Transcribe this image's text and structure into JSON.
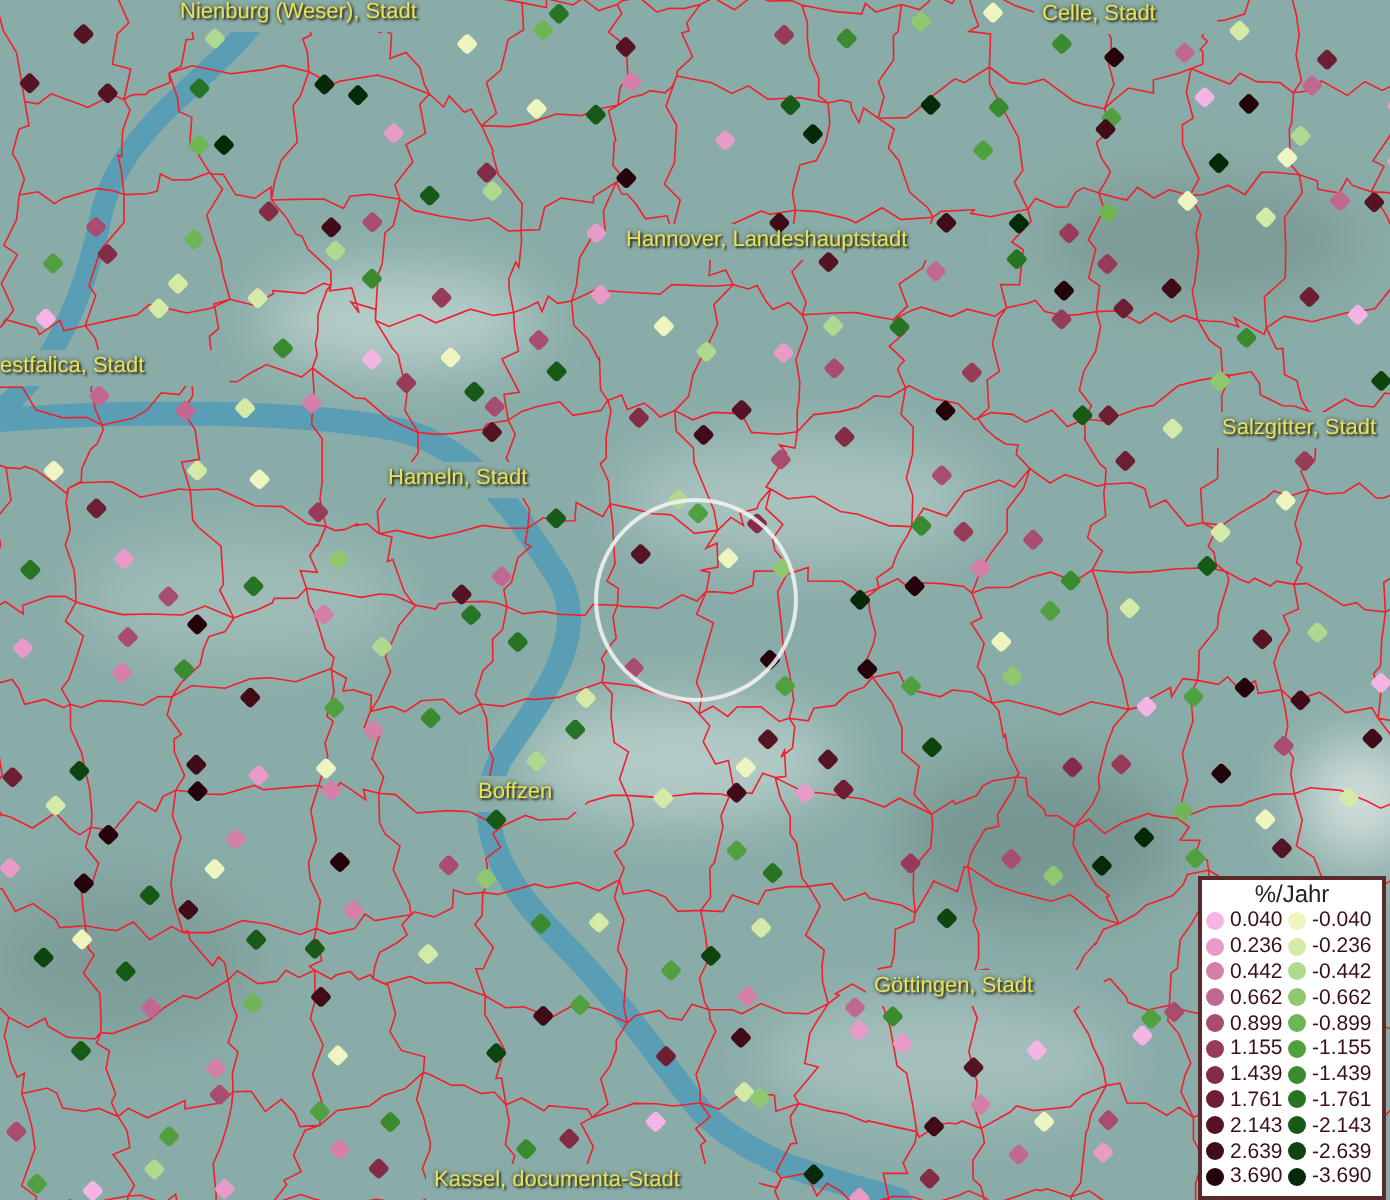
{
  "map": {
    "place_labels": [
      "Nienburg (Weser), Stadt",
      "Celle, Stadt",
      "Hannover, Landeshauptstadt",
      "estfalica, Stadt",
      "Salzgitter, Stadt",
      "Hameln, Stadt",
      "Boffzen",
      "Göttingen, Stadt",
      "Kassel, documenta-Stadt"
    ]
  },
  "legend": {
    "title": "%/Jahr",
    "entries": [
      {
        "label": "0.040",
        "color": "#f5b4e6"
      },
      {
        "label": "-0.040",
        "color": "#eef5c0"
      },
      {
        "label": "0.236",
        "color": "#e89bc8"
      },
      {
        "label": "-0.236",
        "color": "#d6eaa8"
      },
      {
        "label": "0.442",
        "color": "#d47fa8"
      },
      {
        "label": "-0.442",
        "color": "#b0d890"
      },
      {
        "label": "0.662",
        "color": "#c06890"
      },
      {
        "label": "-0.662",
        "color": "#90c870"
      },
      {
        "label": "0.899",
        "color": "#a84d70"
      },
      {
        "label": "-0.899",
        "color": "#6fb455"
      },
      {
        "label": "1.155",
        "color": "#963c58"
      },
      {
        "label": "-1.155",
        "color": "#50a040"
      },
      {
        "label": "1.439",
        "color": "#822d45"
      },
      {
        "label": "-1.439",
        "color": "#3a8a30"
      },
      {
        "label": "1.761",
        "color": "#6e1e33"
      },
      {
        "label": "-1.761",
        "color": "#267424"
      },
      {
        "label": "2.143",
        "color": "#551424"
      },
      {
        "label": "-2.143",
        "color": "#175a18"
      },
      {
        "label": "2.639",
        "color": "#3f0c18"
      },
      {
        "label": "-2.639",
        "color": "#0e4410"
      },
      {
        "label": "3.690",
        "color": "#24040a"
      },
      {
        "label": "-3.690",
        "color": "#062a08"
      }
    ]
  }
}
